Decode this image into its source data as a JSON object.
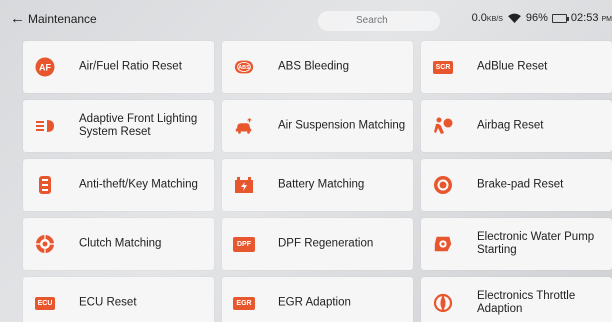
{
  "header": {
    "back_icon": "left-arrow-icon",
    "title": "Maintenance",
    "search_placeholder": "Search"
  },
  "status": {
    "speed_value": "0.0",
    "speed_unit": "KB/S",
    "battery_percent": "96%",
    "time": "02:53",
    "time_suffix": "PM"
  },
  "accent_color": "#e8562e",
  "functions": [
    {
      "label": "Air/Fuel Ratio Reset",
      "icon": "af-badge-icon"
    },
    {
      "label": "ABS Bleeding",
      "icon": "abs-brake-icon"
    },
    {
      "label": "AdBlue Reset",
      "icon": "scr-badge-icon"
    },
    {
      "label": "Adaptive Front Lighting System Reset",
      "icon": "headlight-icon"
    },
    {
      "label": "Air Suspension Matching",
      "icon": "car-suspension-icon"
    },
    {
      "label": "Airbag Reset",
      "icon": "airbag-icon"
    },
    {
      "label": "Anti-theft/Key Matching",
      "icon": "key-fob-icon"
    },
    {
      "label": "Battery Matching",
      "icon": "battery-icon"
    },
    {
      "label": "Brake-pad Reset",
      "icon": "brake-disc-icon"
    },
    {
      "label": "Clutch Matching",
      "icon": "clutch-icon"
    },
    {
      "label": "DPF Regeneration",
      "icon": "dpf-badge-icon"
    },
    {
      "label": "Electronic Water Pump Starting",
      "icon": "water-pump-icon"
    },
    {
      "label": "ECU Reset",
      "icon": "ecu-badge-icon"
    },
    {
      "label": "EGR Adaption",
      "icon": "egr-badge-icon"
    },
    {
      "label": "Electronics Throttle Adaption",
      "icon": "throttle-icon"
    }
  ]
}
